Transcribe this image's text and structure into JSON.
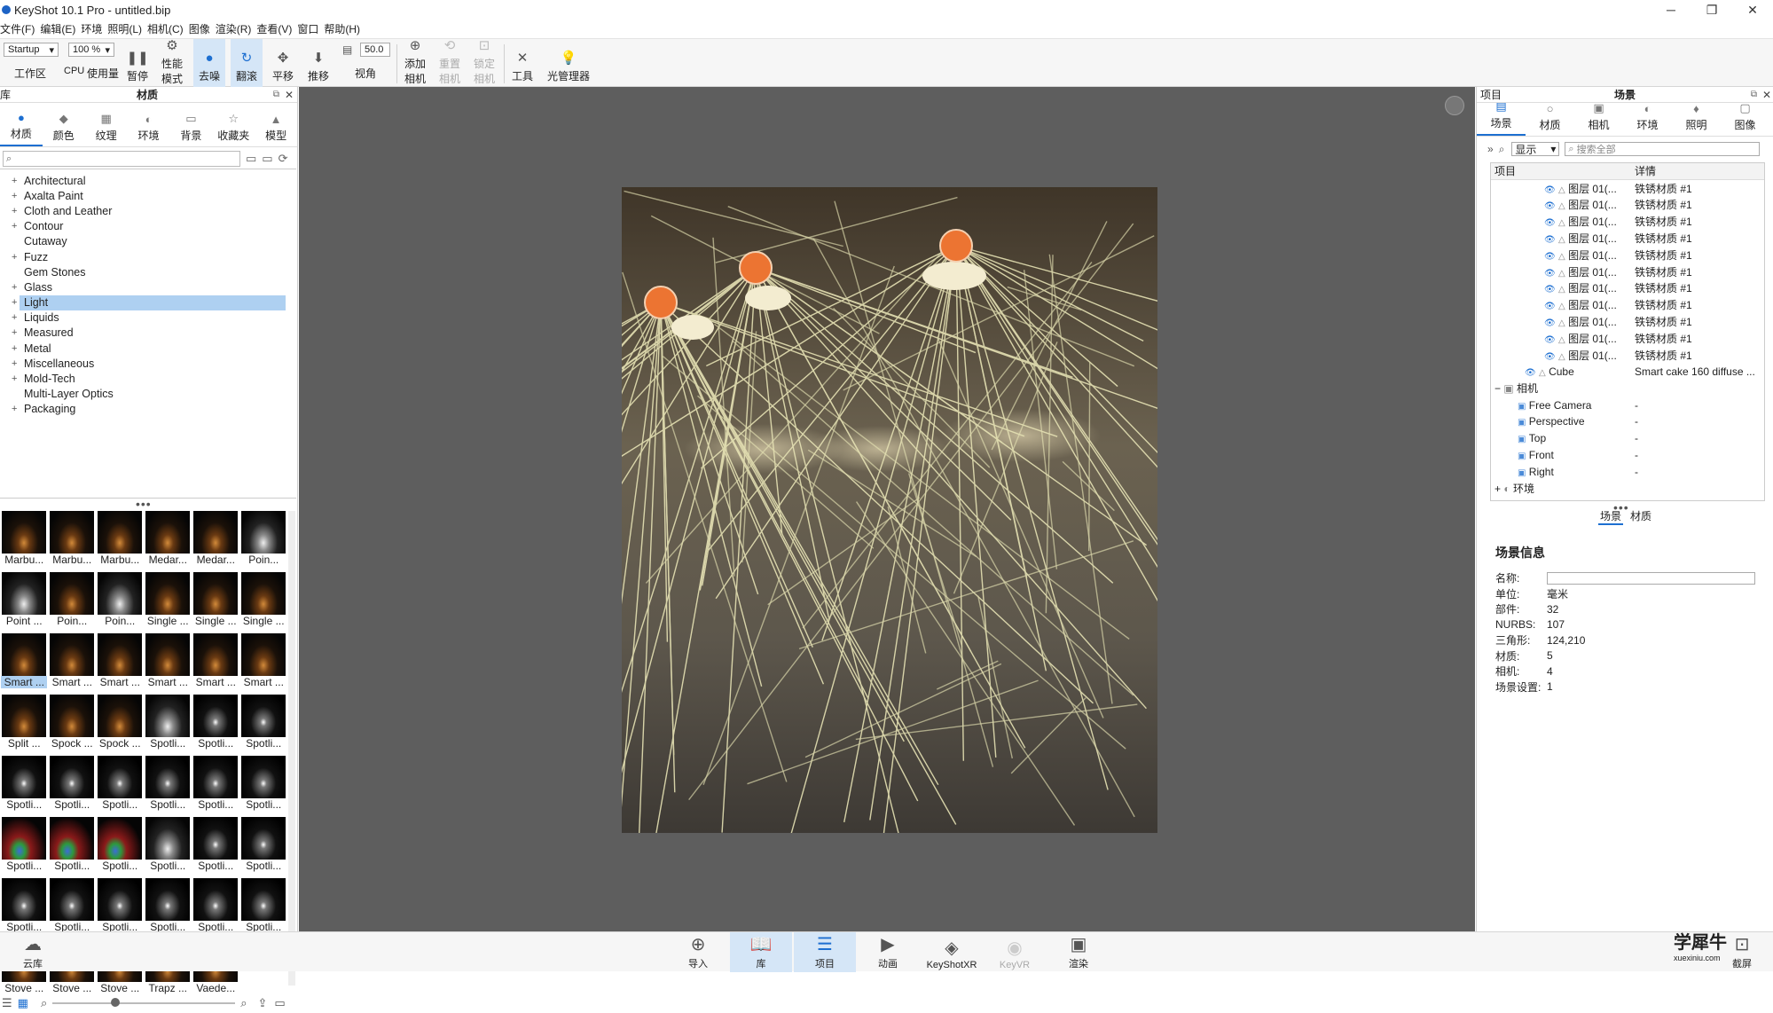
{
  "window": {
    "title": "KeyShot 10.1 Pro  - untitled.bip",
    "minimize": "─",
    "maximize": "❐",
    "close": "✕"
  },
  "menu": [
    "文件(F)",
    "编辑(E)",
    "环境",
    "照明(L)",
    "相机(C)",
    "图像",
    "渲染(R)",
    "查看(V)",
    "窗口",
    "帮助(H)"
  ],
  "toolbar": {
    "workspace_value": "Startup",
    "workspace_label": "工作区",
    "cpu_value": "100 %",
    "cpu_label": "CPU",
    "usage_label": "使用量",
    "pause_label": "暂停",
    "perf_label_1": "性能",
    "perf_label_2": "模式",
    "denoise_label": "去噪",
    "tumble_label": "翻滚",
    "pan_label": "平移",
    "dolly_label": "推移",
    "fov_value": "50.0",
    "fov_label": "视角",
    "add_camera_1": "添加",
    "add_camera_2": "相机",
    "reset_camera_1": "重置",
    "reset_camera_2": "相机",
    "lock_camera_1": "锁定",
    "lock_camera_2": "相机",
    "tools_label": "工具",
    "light_manager_label": "光管理器"
  },
  "library": {
    "panel_left": "库",
    "panel_title": "材质",
    "tabs": [
      "材质",
      "颜色",
      "纹理",
      "环境",
      "背景",
      "收藏夹",
      "模型"
    ],
    "tree": [
      "Architectural",
      "Axalta Paint",
      "Cloth and Leather",
      "Contour",
      "Cutaway",
      "Fuzz",
      "Gem Stones",
      "Glass",
      "Light",
      "Liquids",
      "Measured",
      "Metal",
      "Miscellaneous",
      "Mold-Tech",
      "Multi-Layer Optics",
      "Packaging"
    ],
    "selected_tree": "Light",
    "thumbs": [
      "Marbu...",
      "Marbu...",
      "Marbu...",
      "Medar...",
      "Medar...",
      "Poin...",
      "Point ...",
      "Poin...",
      "Poin...",
      "Single ...",
      "Single ...",
      "Single ...",
      "Smart ...",
      "Smart ...",
      "Smart ...",
      "Smart ...",
      "Smart ...",
      "Smart ...",
      "Split ...",
      "Spock ...",
      "Spock ...",
      "Spotli...",
      "Spotli...",
      "Spotli...",
      "Spotli...",
      "Spotli...",
      "Spotli...",
      "Spotli...",
      "Spotli...",
      "Spotli...",
      "Spotli...",
      "Spotli...",
      "Spotli...",
      "Spotli...",
      "Spotli...",
      "Spotli...",
      "Spotli...",
      "Spotli...",
      "Spotli...",
      "Spotli...",
      "Spotli...",
      "Spotli...",
      "Stove ...",
      "Stove ...",
      "Stove ...",
      "Trapz ...",
      "Vaede..."
    ]
  },
  "project": {
    "panel_left": "项目",
    "panel_title": "场景",
    "tabs": [
      "场景",
      "材质",
      "相机",
      "环境",
      "照明",
      "图像"
    ],
    "show_label": "显示",
    "search_placeholder": "搜索全部",
    "col_item": "项目",
    "col_detail": "详情",
    "layer_rows": [
      {
        "name": "图层 01(...",
        "detail": "铁锈材质 #1"
      },
      {
        "name": "图层 01(...",
        "detail": "铁锈材质 #1"
      },
      {
        "name": "图层 01(...",
        "detail": "铁锈材质 #1"
      },
      {
        "name": "图层 01(...",
        "detail": "铁锈材质 #1"
      },
      {
        "name": "图层 01(...",
        "detail": "铁锈材质 #1"
      },
      {
        "name": "图层 01(...",
        "detail": "铁锈材质 #1"
      },
      {
        "name": "图层 01(...",
        "detail": "铁锈材质 #1"
      },
      {
        "name": "图层 01(...",
        "detail": "铁锈材质 #1"
      },
      {
        "name": "图层 01(...",
        "detail": "铁锈材质 #1"
      },
      {
        "name": "图层 01(...",
        "detail": "铁锈材质 #1"
      },
      {
        "name": "图层 01(...",
        "detail": "铁锈材质 #1"
      }
    ],
    "cube_name": "Cube",
    "cube_detail": "Smart cake 160 diffuse ...",
    "cameras_label": "相机",
    "cameras": [
      {
        "name": "Free Camera",
        "detail": "-"
      },
      {
        "name": "Perspective",
        "detail": "-"
      },
      {
        "name": "Top",
        "detail": "-"
      },
      {
        "name": "Front",
        "detail": "-"
      },
      {
        "name": "Right",
        "detail": "-"
      }
    ],
    "env_label": "环境",
    "sub_tab_scene": "场景",
    "sub_tab_material": "材质",
    "info": {
      "title": "场景信息",
      "name_label": "名称:",
      "unit_label": "单位:",
      "unit": "毫米",
      "parts_label": "部件:",
      "parts": "32",
      "nurbs_label": "NURBS:",
      "nurbs": "107",
      "tri_label": "三角形:",
      "tri": "124,210",
      "mat_label": "材质:",
      "mat": "5",
      "cam_label": "相机:",
      "cam": "4",
      "scene_set_label": "场景设置:",
      "scene_set": "1"
    }
  },
  "bottombar": {
    "cloud": "云库",
    "import": "导入",
    "library": "库",
    "project": "项目",
    "animation": "动画",
    "keyshotxr": "KeyShotXR",
    "keyvr": "KeyVR",
    "render": "渲染",
    "screenshot": "截屏"
  },
  "watermark": {
    "main": "学犀牛",
    "sub": "xuexiniu.com"
  }
}
